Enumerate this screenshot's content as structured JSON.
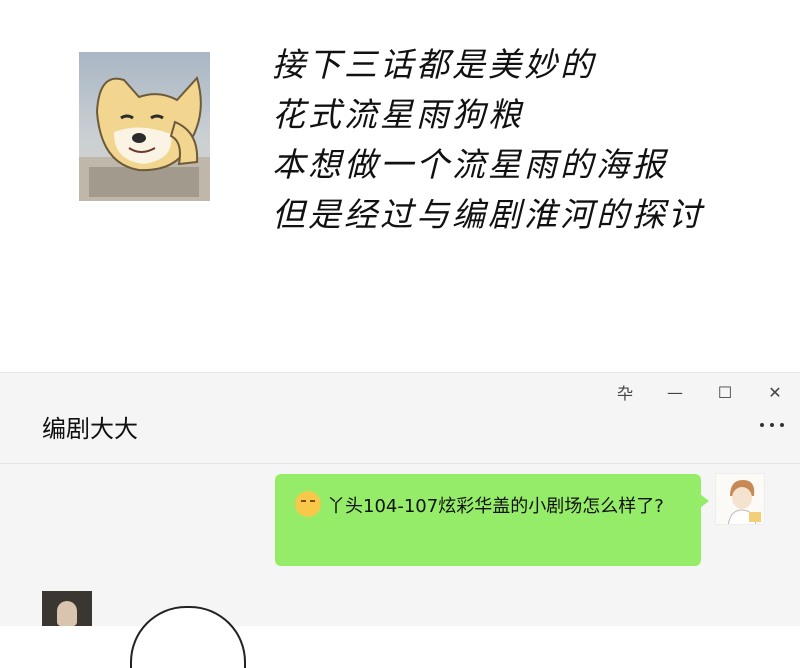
{
  "narration": {
    "lines": [
      "接下三话都是美妙的",
      "花式流星雨狗粮",
      "本想做一个流星雨的海报",
      "但是经过与编剧淮河的探讨"
    ],
    "image": "shiba-dog-meme"
  },
  "chat": {
    "window_controls": {
      "pin": "卆",
      "minimize": "—",
      "maximize": "☐",
      "close": "✕"
    },
    "title": "编剧大大",
    "more": "more-dots-icon",
    "messages": [
      {
        "side": "right",
        "emoji": "blush-emoji",
        "text": "丫头104-107炫彩华盖的小剧场怎么样了?"
      }
    ]
  },
  "colors": {
    "bubble_green": "#95ec69",
    "chat_bg": "#f5f5f5"
  }
}
